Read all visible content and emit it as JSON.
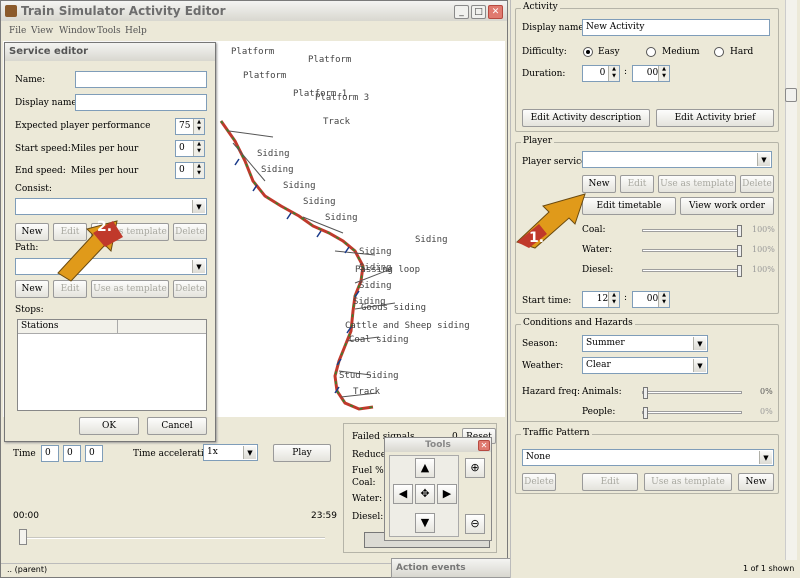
{
  "main_window": {
    "title": "Train Simulator Activity Editor",
    "menu": [
      "File",
      "View",
      "Window",
      "Tools",
      "Help"
    ],
    "status_left": "..  (parent)",
    "status_right": "1 of 1 shown"
  },
  "map": {
    "labels": [
      "Platform",
      "Platform",
      "Platform",
      "Track",
      "Siding",
      "Siding",
      "Siding",
      "Siding",
      "Siding",
      "Siding",
      "Siding",
      "Siding",
      "Siding",
      "Siding",
      "Cattle and Sheep siding",
      "Coal siding",
      "Passing loop",
      "Goods siding",
      "Platform 1",
      "Platform 3",
      "Stud Siding",
      "Track"
    ]
  },
  "playback": {
    "time_label": "Time",
    "time_fields": [
      "0",
      "0",
      "0"
    ],
    "accel_label": "Time acceleration",
    "accel_value": "1x",
    "play_label": "Play",
    "start_time": "00:00",
    "end_time": "23:59"
  },
  "consumption": {
    "failed_signals": "Failed signals",
    "failed_value": "0",
    "reset_label": "Reset",
    "reduced": "Reduced s",
    "fuel": "Fuel %",
    "coal": "Coal:",
    "water": "Water:",
    "diesel": "Diesel:"
  },
  "tools": {
    "title": "Tools"
  },
  "action_events": {
    "title": "Action events"
  },
  "service_editor": {
    "title": "Service editor",
    "name_label": "Name:",
    "display_name_label": "Display name:",
    "performance_label": "Expected player performance",
    "performance_value": "75",
    "start_speed_label": "Start speed:",
    "end_speed_label": "End speed:",
    "speed_unit": "Miles per hour",
    "start_speed_value": "0",
    "end_speed_value": "0",
    "consist_label": "Consist:",
    "path_label": "Path:",
    "stops_label": "Stops:",
    "stations_header": "Stations",
    "new_label": "New",
    "edit_label": "Edit",
    "template_label": "Use as template",
    "delete_label": "Delete",
    "ok_label": "OK",
    "cancel_label": "Cancel",
    "callout": "2."
  },
  "activity": {
    "group_title": "Activity",
    "display_name_label": "Display name:",
    "display_name_value": "New Activity",
    "difficulty_label": "Difficulty:",
    "difficulty_options": [
      "Easy",
      "Medium",
      "Hard"
    ],
    "difficulty_selected": "Easy",
    "duration_label": "Duration:",
    "duration_h": "0",
    "duration_m": "00",
    "edit_description": "Edit Activity description",
    "edit_brief": "Edit Activity brief"
  },
  "player": {
    "group_title": "Player",
    "service_label": "Player service:",
    "new_label": "New",
    "edit_label": "Edit",
    "template_label": "Use as template",
    "delete_label": "Delete",
    "edit_timetable": "Edit timetable",
    "view_work_order": "View work order",
    "coal_label": "Coal:",
    "water_label": "Water:",
    "diesel_label": "Diesel:",
    "coal_pct": "100%",
    "water_pct": "100%",
    "diesel_pct": "100%",
    "start_time_label": "Start time:",
    "start_h": "12",
    "start_m": "00",
    "callout": "1."
  },
  "conditions": {
    "group_title": "Conditions and Hazards",
    "season_label": "Season:",
    "season_value": "Summer",
    "weather_label": "Weather:",
    "weather_value": "Clear",
    "hazard_label": "Hazard freq:",
    "animals_label": "Animals:",
    "people_label": "People:",
    "animals_pct": "0%",
    "people_pct": "0%"
  },
  "traffic": {
    "group_title": "Traffic Pattern",
    "value": "None",
    "delete_label": "Delete",
    "edit_label": "Edit",
    "template_label": "Use as template",
    "new_label": "New"
  }
}
